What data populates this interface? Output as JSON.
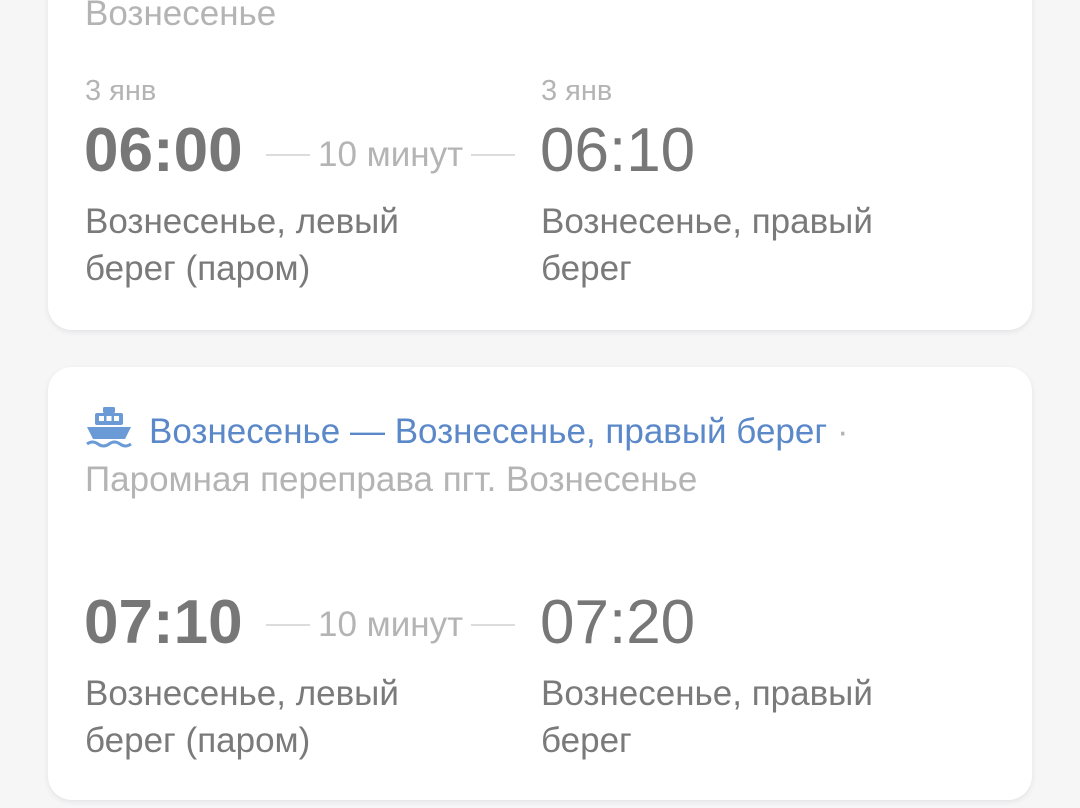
{
  "colors": {
    "background": "#f6f6f7",
    "card": "#ffffff",
    "link": "#5b88c8",
    "muted": "#b4b4b4",
    "text": "#7a7a7a"
  },
  "trips": [
    {
      "route_title": "",
      "route_subtitle": "Вознесенье",
      "departure": {
        "date": "3 янв",
        "time": "06:00",
        "station": "Вознесенье, левый берег (паром)"
      },
      "duration": "10 минут",
      "arrival": {
        "date": "3 янв",
        "time": "06:10",
        "station": "Вознесенье, правый берег"
      }
    },
    {
      "transport_icon": "ferry-icon",
      "route_title": "Вознесенье — Вознесенье, правый берег",
      "route_separator": "·",
      "route_subtitle": "Паромная переправа пгт. Вознесенье",
      "departure": {
        "time": "07:10",
        "station": "Вознесенье, левый берег (паром)"
      },
      "duration": "10 минут",
      "arrival": {
        "time": "07:20",
        "station": "Вознесенье, правый берег"
      }
    }
  ]
}
